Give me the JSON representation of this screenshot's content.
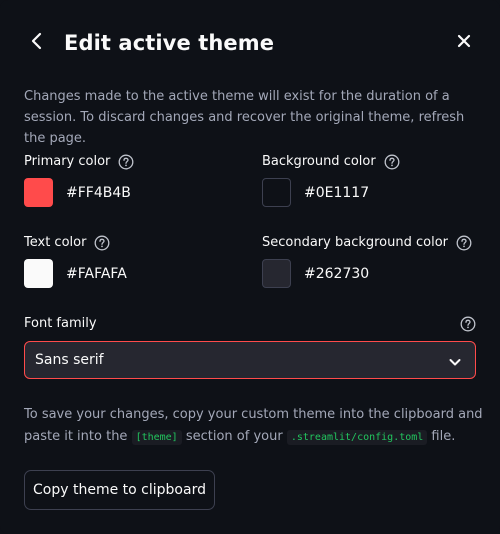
{
  "dialog": {
    "title": "Edit active theme",
    "description": "Changes made to the active theme will exist for the duration of a session. To discard changes and recover the original theme, refresh the page."
  },
  "colors": {
    "primary": {
      "label": "Primary color",
      "value": "#FF4B4B",
      "swatch": "#ff4b4b"
    },
    "background": {
      "label": "Background color",
      "value": "#0E1117",
      "swatch": "#0e1117"
    },
    "text": {
      "label": "Text color",
      "value": "#FAFAFA",
      "swatch": "#fafafa"
    },
    "secondary_background": {
      "label": "Secondary background color",
      "value": "#262730",
      "swatch": "#262730"
    }
  },
  "font": {
    "label": "Font family",
    "selected": "Sans serif"
  },
  "footer": {
    "text_before": "To save your changes, copy your custom theme into the clipboard and paste it into the ",
    "code1": "[theme]",
    "text_middle": " section of your ",
    "code2": ".streamlit/config.toml",
    "text_after": " file.",
    "copy_button": "Copy theme to clipboard"
  },
  "icons": {
    "back": "chevron-left-icon",
    "close": "close-icon",
    "help": "question-circle-icon",
    "dropdown": "chevron-down-icon"
  }
}
